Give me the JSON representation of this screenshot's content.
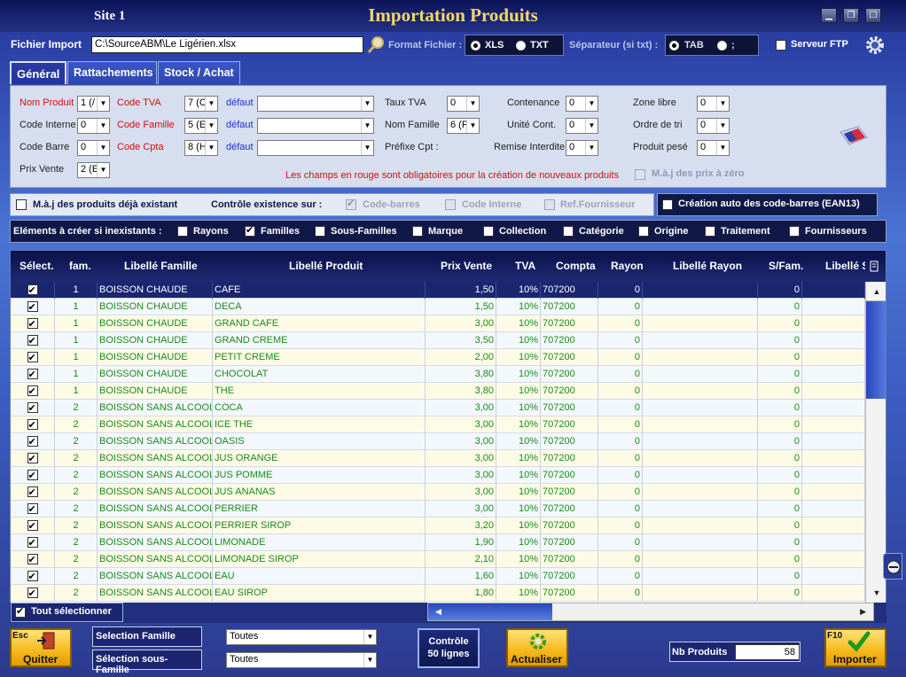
{
  "window": {
    "site": "Site 1",
    "title": "Importation Produits"
  },
  "file": {
    "label": "Fichier Import",
    "path": "C:\\SourceABM\\Le Ligérien.xlsx",
    "format_label": "Format Fichier :",
    "format_options": [
      "XLS",
      "TXT"
    ],
    "format_selected": "XLS",
    "separator_label": "Séparateur (si txt) :",
    "separator_options": [
      "TAB",
      ";"
    ],
    "separator_selected": "TAB",
    "ftp_label": "Serveur FTP",
    "ftp_checked": false
  },
  "tabs": [
    {
      "label": "Général",
      "active": true
    },
    {
      "label": "Rattachements",
      "active": false
    },
    {
      "label": "Stock / Achat",
      "active": false
    }
  ],
  "params": {
    "nom_produit": {
      "label": "Nom Produit",
      "value": "1 (/"
    },
    "code_interne": {
      "label": "Code Interne",
      "value": "0"
    },
    "code_barre": {
      "label": "Code Barre",
      "value": "0"
    },
    "prix_vente": {
      "label": "Prix Vente",
      "value": "2 (E"
    },
    "code_tva": {
      "label": "Code TVA",
      "value": "7 (C"
    },
    "code_famille": {
      "label": "Code Famille",
      "value": "5 (E"
    },
    "code_cpta": {
      "label": "Code Cpta",
      "value": "8 (H"
    },
    "defaut_label": "défaut",
    "taux_tva": {
      "label": "Taux TVA",
      "value": "0"
    },
    "nom_famille": {
      "label": "Nom Famille",
      "value": "6 (F"
    },
    "prefixe_cpt": {
      "label": "Préfixe Cpt :"
    },
    "contenance": {
      "label": "Contenance",
      "value": "0"
    },
    "unite_cont": {
      "label": "Unité Cont.",
      "value": "0"
    },
    "remise_interdite": {
      "label": "Remise Interdite",
      "value": "0"
    },
    "zone_libre": {
      "label": "Zone libre",
      "value": "0"
    },
    "ordre_tri": {
      "label": "Ordre de tri",
      "value": "0"
    },
    "produit_pese": {
      "label": "Produit pesé",
      "value": "0"
    },
    "required_note": "Les champs en rouge sont obligatoires pour la création de nouveaux produits",
    "maj_prix_label": "M.à.j des prix à zéro"
  },
  "options": {
    "maj_existants": "M.à.j des produits déjà existant",
    "controle_label": "Contrôle existence sur :",
    "controle_items": [
      {
        "label": "Code-barres",
        "checked": true
      },
      {
        "label": "Code Interne",
        "checked": false
      },
      {
        "label": "Ref.Fournisseur",
        "checked": false
      }
    ],
    "creation_auto": "Création auto des code-barres (EAN13)",
    "elements_label": "Eléments à créer si inexistants :",
    "elements": [
      {
        "label": "Rayons",
        "checked": false
      },
      {
        "label": "Familles",
        "checked": true
      },
      {
        "label": "Sous-Familles",
        "checked": false
      },
      {
        "label": "Marque",
        "checked": false
      },
      {
        "label": "Collection",
        "checked": false
      },
      {
        "label": "Catégorie",
        "checked": false
      },
      {
        "label": "Origine",
        "checked": false
      },
      {
        "label": "Traitement",
        "checked": false
      },
      {
        "label": "Fournisseurs",
        "checked": false
      }
    ]
  },
  "grid": {
    "headers": [
      "Sélect.",
      "fam.",
      "Libellé Famille",
      "Libellé Produit",
      "Prix Vente",
      "TVA",
      "Compta",
      "Rayon",
      "Libellé Rayon",
      "S/Fam.",
      "Libellé S"
    ],
    "rows": [
      [
        "1",
        "BOISSON CHAUDE",
        "CAFE",
        "1,50",
        "10%",
        "707200",
        "0",
        "",
        "0"
      ],
      [
        "1",
        "BOISSON CHAUDE",
        "DECA",
        "1,50",
        "10%",
        "707200",
        "0",
        "",
        "0"
      ],
      [
        "1",
        "BOISSON CHAUDE",
        "GRAND CAFE",
        "3,00",
        "10%",
        "707200",
        "0",
        "",
        "0"
      ],
      [
        "1",
        "BOISSON CHAUDE",
        "GRAND CREME",
        "3,50",
        "10%",
        "707200",
        "0",
        "",
        "0"
      ],
      [
        "1",
        "BOISSON CHAUDE",
        "PETIT CREME",
        "2,00",
        "10%",
        "707200",
        "0",
        "",
        "0"
      ],
      [
        "1",
        "BOISSON CHAUDE",
        "CHOCOLAT",
        "3,80",
        "10%",
        "707200",
        "0",
        "",
        "0"
      ],
      [
        "1",
        "BOISSON CHAUDE",
        "THE",
        "3,80",
        "10%",
        "707200",
        "0",
        "",
        "0"
      ],
      [
        "2",
        "BOISSON SANS ALCOOL",
        "COCA",
        "3,00",
        "10%",
        "707200",
        "0",
        "",
        "0"
      ],
      [
        "2",
        "BOISSON SANS ALCOOL",
        "ICE THE",
        "3,00",
        "10%",
        "707200",
        "0",
        "",
        "0"
      ],
      [
        "2",
        "BOISSON SANS ALCOOL",
        "OASIS",
        "3,00",
        "10%",
        "707200",
        "0",
        "",
        "0"
      ],
      [
        "2",
        "BOISSON SANS ALCOOL",
        "JUS ORANGE",
        "3,00",
        "10%",
        "707200",
        "0",
        "",
        "0"
      ],
      [
        "2",
        "BOISSON SANS ALCOOL",
        "JUS POMME",
        "3,00",
        "10%",
        "707200",
        "0",
        "",
        "0"
      ],
      [
        "2",
        "BOISSON SANS ALCOOL",
        "JUS ANANAS",
        "3,00",
        "10%",
        "707200",
        "0",
        "",
        "0"
      ],
      [
        "2",
        "BOISSON SANS ALCOOL",
        "PERRIER",
        "3,00",
        "10%",
        "707200",
        "0",
        "",
        "0"
      ],
      [
        "2",
        "BOISSON SANS ALCOOL",
        "PERRIER SIROP",
        "3,20",
        "10%",
        "707200",
        "0",
        "",
        "0"
      ],
      [
        "2",
        "BOISSON SANS ALCOOL",
        "LIMONADE",
        "1,90",
        "10%",
        "707200",
        "0",
        "",
        "0"
      ],
      [
        "2",
        "BOISSON SANS ALCOOL",
        "LIMONADE SIROP",
        "2,10",
        "10%",
        "707200",
        "0",
        "",
        "0"
      ],
      [
        "2",
        "BOISSON SANS ALCOOL",
        "EAU",
        "1,60",
        "10%",
        "707200",
        "0",
        "",
        "0"
      ],
      [
        "2",
        "BOISSON SANS ALCOOL",
        "EAU SIROP",
        "1,80",
        "10%",
        "707200",
        "0",
        "",
        "0"
      ]
    ],
    "select_all": "Tout sélectionner"
  },
  "footer": {
    "quit_key": "Esc",
    "quit_label": "Quitter",
    "selection_famille_label": "Selection Famille",
    "selection_famille_value": "Toutes",
    "selection_sousfamille_label": "Sélection sous-Famille",
    "selection_sousfamille_value": "Toutes",
    "controle_label": "Contrôle",
    "controle_sub": "50 lignes",
    "actualiser_label": "Actualiser",
    "nb_produits_label": "Nb Produits",
    "nb_produits_value": "58",
    "import_key": "F10",
    "import_label": "Importer"
  }
}
